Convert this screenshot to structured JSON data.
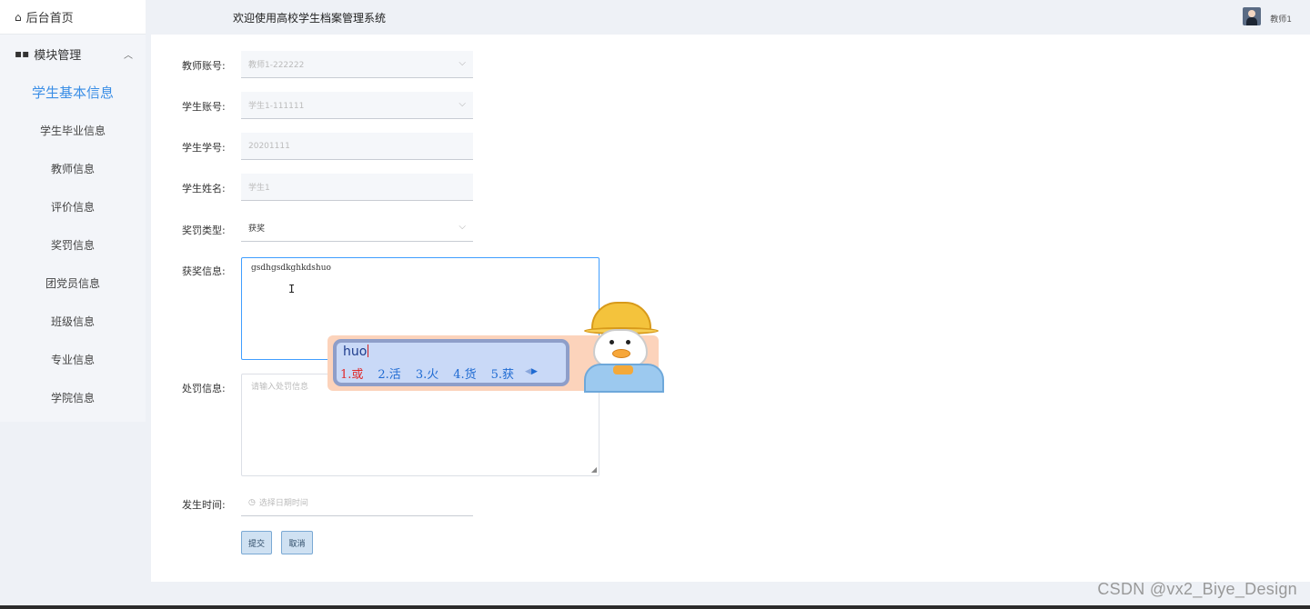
{
  "sidebar": {
    "home_label": "后台首页",
    "module_label": "模块管理",
    "items": [
      {
        "label": "学生基本信息",
        "active": true
      },
      {
        "label": "学生毕业信息"
      },
      {
        "label": "教师信息"
      },
      {
        "label": "评价信息"
      },
      {
        "label": "奖罚信息"
      },
      {
        "label": "团党员信息"
      },
      {
        "label": "班级信息"
      },
      {
        "label": "专业信息"
      },
      {
        "label": "学院信息"
      }
    ]
  },
  "header": {
    "title": "欢迎使用高校学生档案管理系统",
    "username": "教师1"
  },
  "form": {
    "teacher_account": {
      "label": "教师账号:",
      "value": "教师1-222222"
    },
    "student_account": {
      "label": "学生账号:",
      "value": "学生1-111111"
    },
    "student_number": {
      "label": "学生学号:",
      "value": "20201111"
    },
    "student_name": {
      "label": "学生姓名:",
      "value": "学生1"
    },
    "reward_type": {
      "label": "奖罚类型:",
      "value": "获奖"
    },
    "reward_info": {
      "label": "获奖信息:",
      "value": "gsdhgsdkghkdshuo"
    },
    "punish_info": {
      "label": "处罚信息:",
      "placeholder": "请输入处罚信息"
    },
    "occur_time": {
      "label": "发生时间:",
      "placeholder": "选择日期时间"
    },
    "submit_label": "提交",
    "cancel_label": "取消"
  },
  "ime": {
    "input": "huo",
    "candidates": [
      "1.或",
      "2.活",
      "3.火",
      "4.货",
      "5.获"
    ]
  },
  "watermark": "CSDN @vx2_Biye_Design"
}
